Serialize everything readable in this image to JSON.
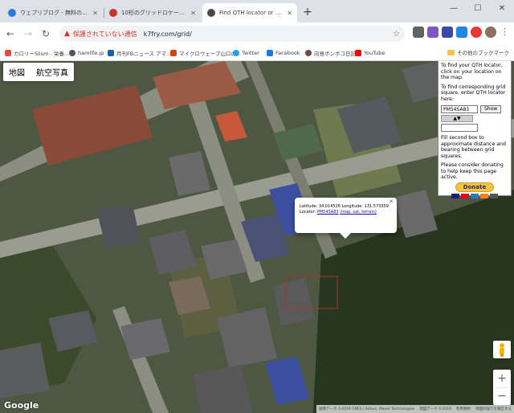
{
  "browser": {
    "tabs": [
      {
        "title": "ウェブリブログ - 無料のブログ(blog)作",
        "active": false,
        "favicon_color": "#2b7bd3"
      },
      {
        "title": "10桁のグリッドロケーターとPSKR: まびこ",
        "active": false,
        "favicon_color": "#c0392b"
      },
      {
        "title": "Find QTH locator or map square",
        "active": true,
        "favicon_color": "#4a4a4a"
      }
    ],
    "new_tab_symbol": "+",
    "window_controls": {
      "minimize": "—",
      "maximize": "☐",
      "close": "✕"
    },
    "address": {
      "warning_label": "保護されていない通信",
      "url": "k7fry.com/grid/"
    },
    "bookmarks": [
      {
        "label": "カロリーSlism - 栄養..."
      },
      {
        "label": "hamlife.jp"
      },
      {
        "label": "月刊FBニュース アマ..."
      },
      {
        "label": "マイクロウェーブ山口の..."
      },
      {
        "label": "Twitter"
      },
      {
        "label": "Facebook"
      },
      {
        "label": "向島ボンボコ日記"
      },
      {
        "label": "YouTube"
      }
    ],
    "other_bookmarks": "その他のブックマーク"
  },
  "map": {
    "map_type": {
      "map": "地図",
      "satellite": "航空写真"
    },
    "google_logo": "Google",
    "attribution": [
      "画像データ ©2019 CNES / Airbus, Maxar Technologies",
      "地図データ ©2019",
      "利用規約",
      "地図の誤りを報告する"
    ]
  },
  "panel": {
    "intro": "To find your QTH locator, click on your location on the map.",
    "grid_intro": "To find corresponding grid square, enter QTH locator here:",
    "locator_value": "PM54SA83",
    "show_label": "Show",
    "arrows": "▲▼",
    "distance_text": "Fill second box to approximate distance and bearing between grid squares.",
    "donate_text": "Please consider donating to help keep this page active.",
    "donate_label": "Donate"
  },
  "infowindow": {
    "lat_label": "Latitude:",
    "lat": "34.014526",
    "lon_label": "Longitude:",
    "lon": "131.573359",
    "locator_label": "Locator:",
    "locator": "PM54SA83",
    "links": "(map, sat, terrain)"
  }
}
